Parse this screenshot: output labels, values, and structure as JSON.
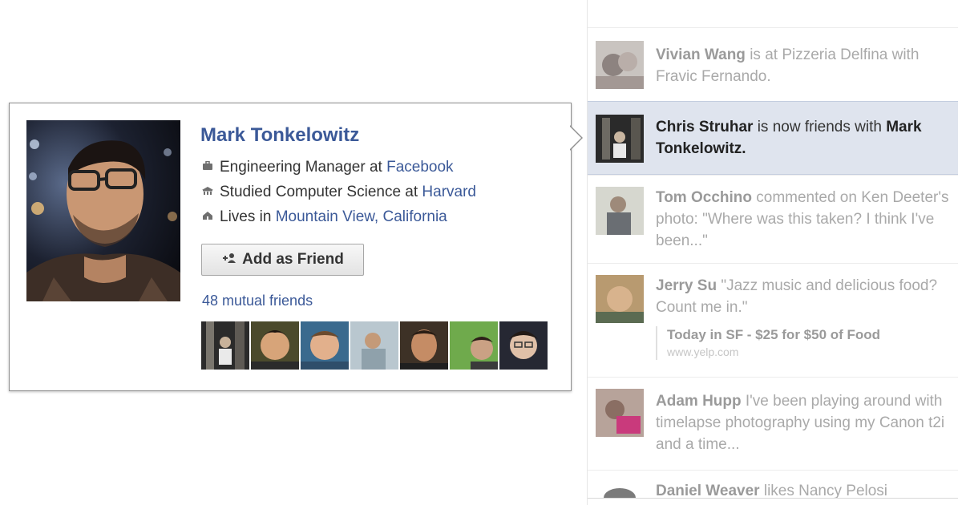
{
  "ticker": {
    "stories": [
      {
        "parts": [
          {
            "t": "Vivian Wang",
            "b": true
          },
          {
            "t": " is at ",
            "b": false
          },
          {
            "t": "Pizzeria Delfina",
            "b": false
          },
          {
            "t": " with ",
            "b": false
          },
          {
            "t": "Fravic Fernando",
            "b": false
          },
          {
            "t": ".",
            "b": false
          }
        ],
        "active": false
      },
      {
        "parts": [
          {
            "t": "Chris Struhar",
            "b": true
          },
          {
            "t": " is now friends with ",
            "b": false
          },
          {
            "t": "Mark Tonkelowitz.",
            "b": true
          }
        ],
        "active": true
      },
      {
        "parts": [
          {
            "t": "Tom Occhino",
            "b": true
          },
          {
            "t": " commented on ",
            "b": false
          },
          {
            "t": "Ken Deeter's photo: \"Where was this taken? I think I've been...\"",
            "b": false
          }
        ],
        "active": false
      },
      {
        "parts": [
          {
            "t": "Jerry Su",
            "b": true
          },
          {
            "t": " \"Jazz music and delicious food? Count me in.\"",
            "b": false
          }
        ],
        "active": false,
        "attachment": {
          "title": "Today in SF - $25 for $50 of Food",
          "url": "www.yelp.com"
        }
      },
      {
        "parts": [
          {
            "t": "Adam Hupp",
            "b": true
          },
          {
            "t": " I've been playing around with timelapse photography using my Canon t2i and a time...",
            "b": false
          }
        ],
        "active": false
      },
      {
        "parts": [
          {
            "t": "Daniel Weaver",
            "b": true
          },
          {
            "t": " likes ",
            "b": false
          },
          {
            "t": "Nancy Pelosi",
            "b": false
          }
        ],
        "active": false
      }
    ]
  },
  "hovercard": {
    "name": "Mark Tonkelowitz",
    "work": {
      "prefix": "Engineering Manager at ",
      "link": "Facebook",
      "icon": "briefcase-icon"
    },
    "education": {
      "prefix": "Studied Computer Science at ",
      "link": "Harvard",
      "icon": "school-icon"
    },
    "location": {
      "prefix": "Lives in ",
      "link": "Mountain View, California",
      "icon": "house-icon"
    },
    "add_friend_label": "Add as Friend",
    "add_friend_icon": "add-friend-icon",
    "mutual_friends": "48 mutual friends"
  },
  "colors": {
    "link": "#3b5998",
    "active_story_bg": "#dfe4ee"
  }
}
